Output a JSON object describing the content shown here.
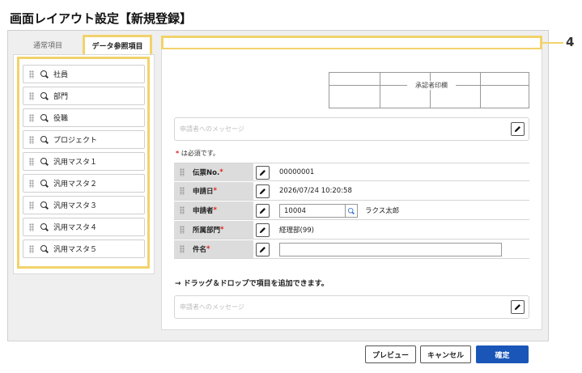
{
  "page_title": "画面レイアウト設定【新規登録】",
  "tabs": {
    "normal": "通常項目",
    "data_ref": "データ参照項目"
  },
  "callout_number": "4",
  "field_items": [
    {
      "label": "社員",
      "icon": "search-icon"
    },
    {
      "label": "部門",
      "icon": "search-icon"
    },
    {
      "label": "役職",
      "icon": "search-icon"
    },
    {
      "label": "プロジェクト",
      "icon": "search-icon"
    },
    {
      "label": "汎用マスタ１",
      "icon": "search-icon"
    },
    {
      "label": "汎用マスタ２",
      "icon": "search-icon"
    },
    {
      "label": "汎用マスタ３",
      "icon": "search-icon"
    },
    {
      "label": "汎用マスタ４",
      "icon": "search-icon"
    },
    {
      "label": "汎用マスタ５",
      "icon": "search-icon"
    }
  ],
  "stamp_label": "承認者印欄",
  "message_placeholder": "申請者へのメッセージ",
  "required_note": {
    "mark": "*",
    "text": " は必須です。"
  },
  "form": {
    "slip_no": {
      "label": "伝票No.",
      "value": "00000001"
    },
    "apply_date": {
      "label": "申請日",
      "value": "2026/07/24 10:20:58"
    },
    "applicant": {
      "label": "申請者",
      "code": "10004",
      "name": "ラクス太郎"
    },
    "dept": {
      "label": "所属部門",
      "value": "経理部(99)"
    },
    "subject": {
      "label": "件名",
      "value": ""
    }
  },
  "required_mark": "*",
  "drag_hint": "→ ドラッグ＆ドロップで項目を追加できます。",
  "buttons": {
    "preview": "プレビュー",
    "cancel": "キャンセル",
    "confirm": "確定"
  },
  "colors": {
    "highlight": "#f2d36b",
    "primary": "#1a56b8",
    "required": "#e0211b"
  }
}
